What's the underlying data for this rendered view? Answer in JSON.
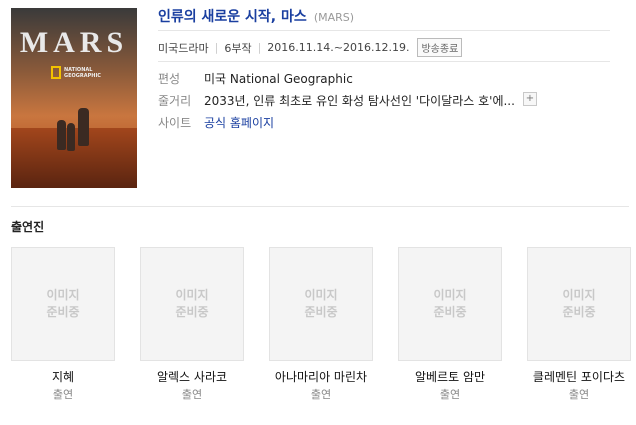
{
  "poster": {
    "title": "MARS",
    "logo_text": "NATIONAL GEOGRAPHIC"
  },
  "title": {
    "ko": "인류의 새로운 시작, 마스",
    "en": "(MARS)"
  },
  "meta": {
    "genre": "미국드라마",
    "episodes": "6부작",
    "dates": "2016.11.14.~2016.12.19.",
    "status": "방송종료"
  },
  "info": {
    "channel_label": "편성",
    "channel_value": "미국 National Geographic",
    "plot_label": "줄거리",
    "plot_value": "2033년, 인류 최초로 유인 화성 탐사선인 '다이달라스 호'에...",
    "plot_more_icon": "+",
    "site_label": "사이트",
    "site_value": "공식 홈페이지"
  },
  "cast_section": {
    "title": "출연진",
    "placeholder": "이미지 준비중",
    "members": [
      {
        "name": "지혜",
        "role": "출연"
      },
      {
        "name": "알렉스 사라코",
        "role": "출연"
      },
      {
        "name": "아나마리아 마린차",
        "role": "출연"
      },
      {
        "name": "알베르토 암만",
        "role": "출연"
      },
      {
        "name": "클레멘틴 포이다츠",
        "role": "출연"
      }
    ]
  }
}
